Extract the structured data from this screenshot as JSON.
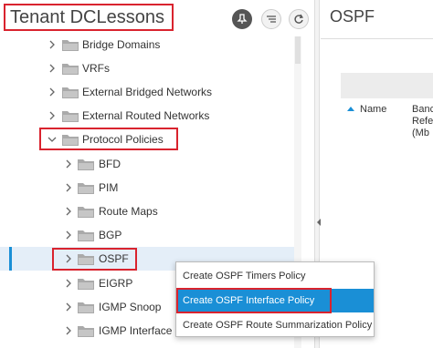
{
  "tenant_title": "Tenant DCLessons",
  "toolbar": {
    "icons": [
      "pin-icon",
      "filter-list-icon",
      "refresh-icon"
    ]
  },
  "tree": {
    "items": [
      {
        "label": "Bridge Domains"
      },
      {
        "label": "VRFs"
      },
      {
        "label": "External Bridged Networks"
      },
      {
        "label": "External Routed Networks"
      },
      {
        "label": "Protocol Policies",
        "expanded": true
      },
      {
        "label": "BFD"
      },
      {
        "label": "PIM"
      },
      {
        "label": "Route Maps"
      },
      {
        "label": "BGP"
      },
      {
        "label": "OSPF",
        "selected": true
      },
      {
        "label": "EIGRP"
      },
      {
        "label": "IGMP Snoop"
      },
      {
        "label": "IGMP Interface"
      }
    ]
  },
  "context_menu": {
    "items": [
      {
        "label": "Create OSPF Timers Policy"
      },
      {
        "label": "Create OSPF Interface Policy",
        "highlighted": true
      },
      {
        "label": "Create OSPF Route Summarization Policy"
      }
    ]
  },
  "right_panel": {
    "title": "OSPF",
    "columns": {
      "name": "Name",
      "bandwidth": "Banc\nRefe\n(Mb"
    }
  },
  "colors": {
    "highlight_red": "#d9232e",
    "accent_blue": "#1a8fd6",
    "folder": "#aaaaaa"
  }
}
